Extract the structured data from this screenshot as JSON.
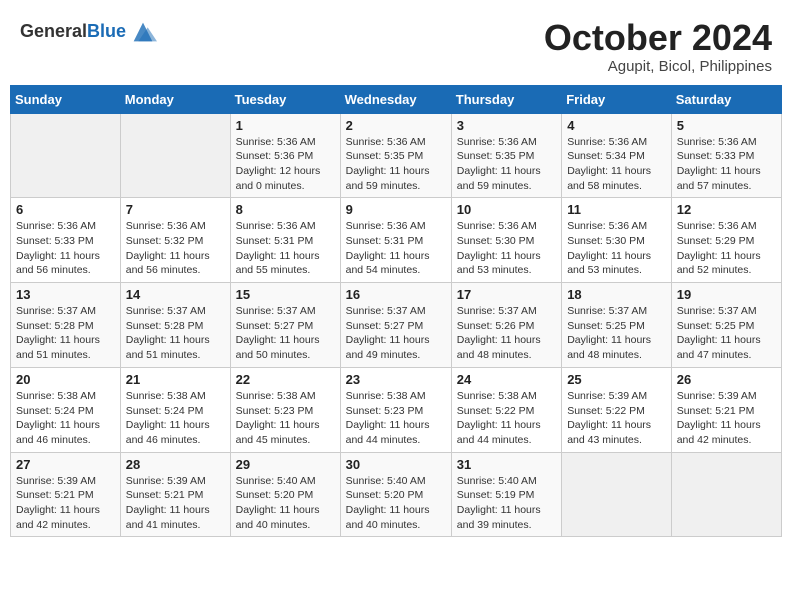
{
  "logo": {
    "general": "General",
    "blue": "Blue"
  },
  "title": "October 2024",
  "subtitle": "Agupit, Bicol, Philippines",
  "days_of_week": [
    "Sunday",
    "Monday",
    "Tuesday",
    "Wednesday",
    "Thursday",
    "Friday",
    "Saturday"
  ],
  "weeks": [
    [
      {
        "day": "",
        "info": ""
      },
      {
        "day": "",
        "info": ""
      },
      {
        "day": "1",
        "info": "Sunrise: 5:36 AM\nSunset: 5:36 PM\nDaylight: 12 hours\nand 0 minutes."
      },
      {
        "day": "2",
        "info": "Sunrise: 5:36 AM\nSunset: 5:35 PM\nDaylight: 11 hours\nand 59 minutes."
      },
      {
        "day": "3",
        "info": "Sunrise: 5:36 AM\nSunset: 5:35 PM\nDaylight: 11 hours\nand 59 minutes."
      },
      {
        "day": "4",
        "info": "Sunrise: 5:36 AM\nSunset: 5:34 PM\nDaylight: 11 hours\nand 58 minutes."
      },
      {
        "day": "5",
        "info": "Sunrise: 5:36 AM\nSunset: 5:33 PM\nDaylight: 11 hours\nand 57 minutes."
      }
    ],
    [
      {
        "day": "6",
        "info": "Sunrise: 5:36 AM\nSunset: 5:33 PM\nDaylight: 11 hours\nand 56 minutes."
      },
      {
        "day": "7",
        "info": "Sunrise: 5:36 AM\nSunset: 5:32 PM\nDaylight: 11 hours\nand 56 minutes."
      },
      {
        "day": "8",
        "info": "Sunrise: 5:36 AM\nSunset: 5:31 PM\nDaylight: 11 hours\nand 55 minutes."
      },
      {
        "day": "9",
        "info": "Sunrise: 5:36 AM\nSunset: 5:31 PM\nDaylight: 11 hours\nand 54 minutes."
      },
      {
        "day": "10",
        "info": "Sunrise: 5:36 AM\nSunset: 5:30 PM\nDaylight: 11 hours\nand 53 minutes."
      },
      {
        "day": "11",
        "info": "Sunrise: 5:36 AM\nSunset: 5:30 PM\nDaylight: 11 hours\nand 53 minutes."
      },
      {
        "day": "12",
        "info": "Sunrise: 5:36 AM\nSunset: 5:29 PM\nDaylight: 11 hours\nand 52 minutes."
      }
    ],
    [
      {
        "day": "13",
        "info": "Sunrise: 5:37 AM\nSunset: 5:28 PM\nDaylight: 11 hours\nand 51 minutes."
      },
      {
        "day": "14",
        "info": "Sunrise: 5:37 AM\nSunset: 5:28 PM\nDaylight: 11 hours\nand 51 minutes."
      },
      {
        "day": "15",
        "info": "Sunrise: 5:37 AM\nSunset: 5:27 PM\nDaylight: 11 hours\nand 50 minutes."
      },
      {
        "day": "16",
        "info": "Sunrise: 5:37 AM\nSunset: 5:27 PM\nDaylight: 11 hours\nand 49 minutes."
      },
      {
        "day": "17",
        "info": "Sunrise: 5:37 AM\nSunset: 5:26 PM\nDaylight: 11 hours\nand 48 minutes."
      },
      {
        "day": "18",
        "info": "Sunrise: 5:37 AM\nSunset: 5:25 PM\nDaylight: 11 hours\nand 48 minutes."
      },
      {
        "day": "19",
        "info": "Sunrise: 5:37 AM\nSunset: 5:25 PM\nDaylight: 11 hours\nand 47 minutes."
      }
    ],
    [
      {
        "day": "20",
        "info": "Sunrise: 5:38 AM\nSunset: 5:24 PM\nDaylight: 11 hours\nand 46 minutes."
      },
      {
        "day": "21",
        "info": "Sunrise: 5:38 AM\nSunset: 5:24 PM\nDaylight: 11 hours\nand 46 minutes."
      },
      {
        "day": "22",
        "info": "Sunrise: 5:38 AM\nSunset: 5:23 PM\nDaylight: 11 hours\nand 45 minutes."
      },
      {
        "day": "23",
        "info": "Sunrise: 5:38 AM\nSunset: 5:23 PM\nDaylight: 11 hours\nand 44 minutes."
      },
      {
        "day": "24",
        "info": "Sunrise: 5:38 AM\nSunset: 5:22 PM\nDaylight: 11 hours\nand 44 minutes."
      },
      {
        "day": "25",
        "info": "Sunrise: 5:39 AM\nSunset: 5:22 PM\nDaylight: 11 hours\nand 43 minutes."
      },
      {
        "day": "26",
        "info": "Sunrise: 5:39 AM\nSunset: 5:21 PM\nDaylight: 11 hours\nand 42 minutes."
      }
    ],
    [
      {
        "day": "27",
        "info": "Sunrise: 5:39 AM\nSunset: 5:21 PM\nDaylight: 11 hours\nand 42 minutes."
      },
      {
        "day": "28",
        "info": "Sunrise: 5:39 AM\nSunset: 5:21 PM\nDaylight: 11 hours\nand 41 minutes."
      },
      {
        "day": "29",
        "info": "Sunrise: 5:40 AM\nSunset: 5:20 PM\nDaylight: 11 hours\nand 40 minutes."
      },
      {
        "day": "30",
        "info": "Sunrise: 5:40 AM\nSunset: 5:20 PM\nDaylight: 11 hours\nand 40 minutes."
      },
      {
        "day": "31",
        "info": "Sunrise: 5:40 AM\nSunset: 5:19 PM\nDaylight: 11 hours\nand 39 minutes."
      },
      {
        "day": "",
        "info": ""
      },
      {
        "day": "",
        "info": ""
      }
    ]
  ]
}
